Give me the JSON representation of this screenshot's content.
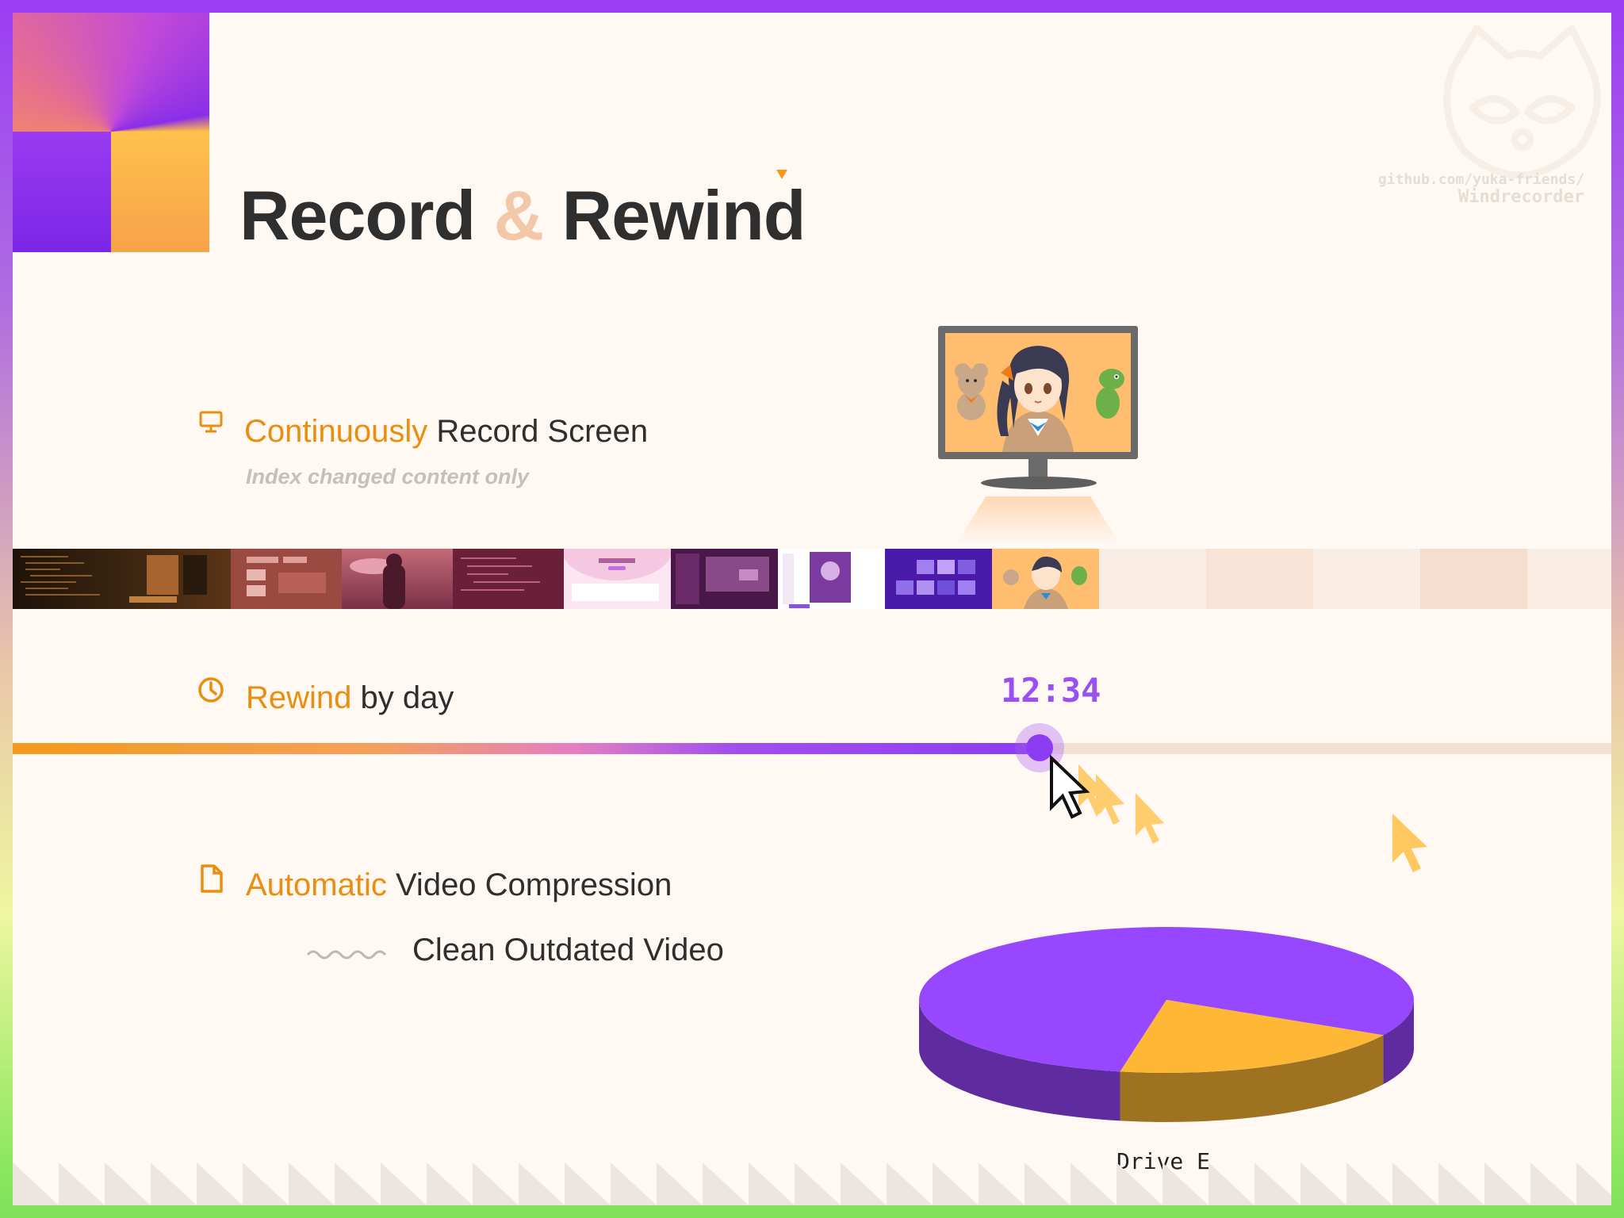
{
  "title": {
    "part1": "Record",
    "amp": "&",
    "part2": "Rewind"
  },
  "repo": {
    "line1": "github.com/yuka-friends/",
    "line2": "Windrecorder"
  },
  "features": [
    {
      "icon": "monitor-icon",
      "highlight": "Continuously",
      "rest": " Record Screen",
      "sub": "Index changed content only"
    },
    {
      "icon": "clock-icon",
      "highlight": "Rewind",
      "rest": " by day"
    },
    {
      "icon": "file-icon",
      "highlight": "Automatic",
      "rest": " Video Compression",
      "sub": "Clean Outdated Video"
    }
  ],
  "timeline": {
    "time": "12:34",
    "progress_percent": 64
  },
  "chart_data": {
    "type": "pie",
    "slices": [
      {
        "label": "",
        "value": 80,
        "color": "#9747ff"
      },
      {
        "label": "",
        "value": 20,
        "color": "#ffb836"
      }
    ],
    "caption": "Drive E"
  },
  "colors": {
    "accent_orange": "#ea8e0f",
    "accent_purple": "#9747ff",
    "text_dark": "#2f2f2f"
  }
}
